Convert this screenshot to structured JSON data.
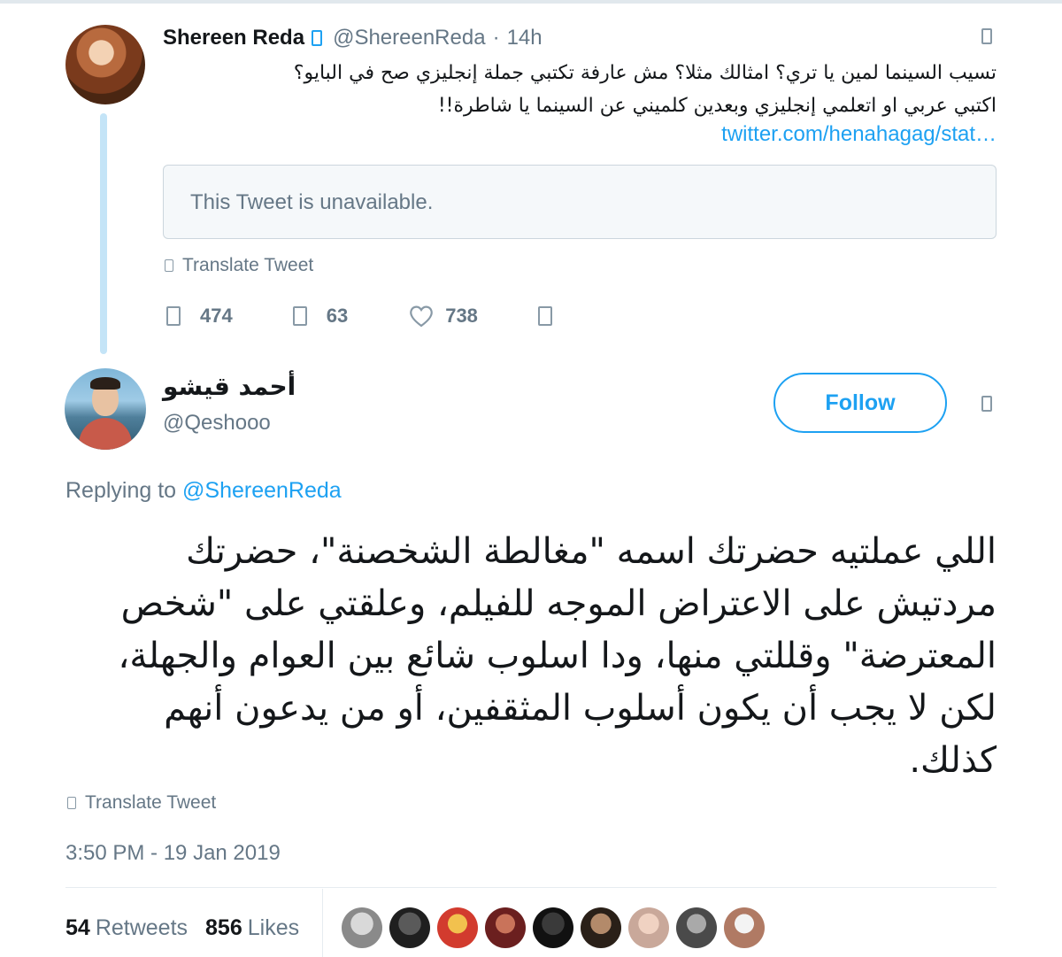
{
  "parent_tweet": {
    "display_name": "Shereen Reda",
    "handle": "@ShereenReda",
    "separator": "·",
    "time_ago": "14h",
    "text_line1": "تسيب السينما لمين يا تري؟ امثالك مثلا؟ مش عارفة تكتبي جملة إنجليزي صح في البايو؟",
    "text_line2": "اكتبي عربي او اتعلمي إنجليزي وبعدين كلميني عن السينما يا شاطرة!!",
    "link": "twitter.com/henahagag/stat…",
    "quoted_unavailable": "This Tweet is unavailable.",
    "translate_label": "Translate Tweet",
    "replies": "474",
    "retweets": "63",
    "likes": "738",
    "icons": {
      "verified": "verified-icon",
      "caret": "chevron-down-icon",
      "reply": "reply-icon",
      "retweet": "retweet-icon",
      "like": "heart-icon",
      "dm": "message-icon",
      "translate": "globe-icon"
    }
  },
  "main_tweet": {
    "display_name": "أحمد قيشو",
    "handle": "@Qeshooo",
    "follow_label": "Follow",
    "replying_prefix": "Replying to",
    "replying_to": "@ShereenReda",
    "text": "اللي عملتيه حضرتك اسمه \"مغالطة الشخصنة\"، حضرتك مردتيش على الاعتراض الموجه للفيلم، وعلقتي على \"شخص المعترضة\" وقللتي منها، ودا اسلوب شائع بين العوام والجهلة، لكن لا يجب أن يكون أسلوب المثقفين، أو من يدعون أنهم كذلك.",
    "translate_label": "Translate Tweet",
    "timestamp": "3:50 PM - 19 Jan 2019",
    "retweets_count": "54",
    "retweets_label": "Retweets",
    "likes_count": "856",
    "likes_label": "Likes"
  },
  "colors": {
    "accent": "#1da1f2",
    "thread_line": "#c4e4f7",
    "muted_text": "#657786",
    "primary_text": "#14171a",
    "quote_bg": "#f5f8fa"
  }
}
